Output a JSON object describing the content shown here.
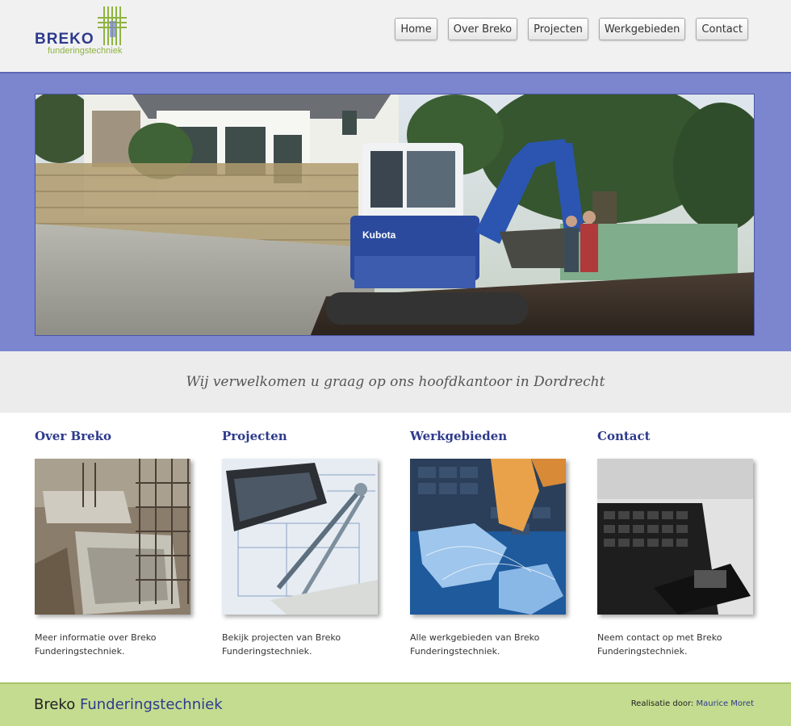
{
  "header": {
    "logo_name": "BREKO",
    "logo_sub": "funderingstechniek",
    "nav": [
      {
        "label": "Home"
      },
      {
        "label": "Over Breko"
      },
      {
        "label": "Projecten"
      },
      {
        "label": "Werkgebieden"
      },
      {
        "label": "Contact"
      }
    ]
  },
  "tagline": "Wij verwelkomen u graag op ons hoofdkantoor in Dordrecht",
  "columns": [
    {
      "title": "Over Breko",
      "text": "Meer informatie over Breko Funderingstechniek."
    },
    {
      "title": "Projecten",
      "text": "Bekijk projecten van Breko Funderingstechniek."
    },
    {
      "title": "Werkgebieden",
      "text": "Alle werkgebieden van Breko Funderingstechniek."
    },
    {
      "title": "Contact",
      "text": "Neem contact op met Breko Funderingstechniek."
    }
  ],
  "footer": {
    "brand_1": "Breko",
    "brand_2": "Funderingstechniek",
    "credit_label": "Realisatie door:",
    "credit_link": "Maurice Moret"
  },
  "colors": {
    "brand_blue": "#2d3a8c",
    "hero_band": "#7b86cf",
    "footer_green": "#c4dc8f",
    "logo_green": "#8fb341"
  }
}
